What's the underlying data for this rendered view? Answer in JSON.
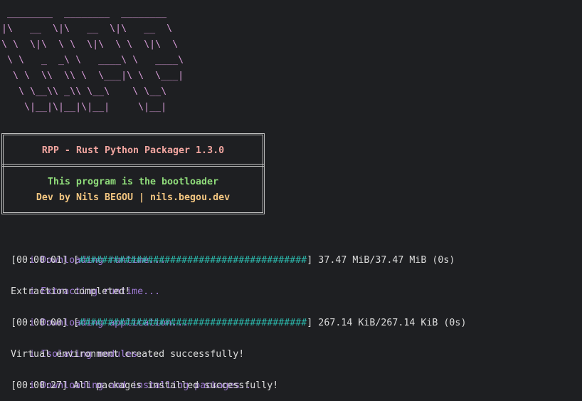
{
  "ascii_logo": [
    " ________  ________  ________",
    "|\\   __  \\|\\   __  \\|\\   __  \\",
    "\\ \\  \\|\\  \\ \\  \\|\\  \\ \\  \\|\\  \\",
    " \\ \\   _  _\\ \\   ____\\ \\   ____\\",
    "  \\ \\  \\\\  \\\\ \\  \\___|\\ \\  \\___|",
    "   \\ \\__\\\\ _\\\\ \\__\\    \\ \\__\\",
    "    \\|__|\\|__|\\|__|     \\|__|"
  ],
  "banner": {
    "title": "RPP - Rust Python Packager 1.3.0",
    "subtitle": "This program is the bootloader",
    "credit": "Dev by Nils BEGOU | nils.begou.dev"
  },
  "colors": {
    "background": "#1e1f22",
    "logo": "#d59ad6",
    "title": "#f2a6a0",
    "subtitle": "#8fdb7a",
    "credit": "#f2c580",
    "info": "#a07bd6",
    "progress": "#2bb4a8"
  },
  "log": {
    "info_icon": "i",
    "step1": "Downloading runtime...",
    "step1_time": "[00:00:01] [",
    "step1_bar": "########################################",
    "step1_end": "] 37.47 MiB/37.47 MiB (0s)",
    "step2": "Extracting runtime...",
    "step2_result": "Extraction completed!",
    "step3": "Downloading application...",
    "step3_time": "[00:00:00] [",
    "step3_bar": "########################################",
    "step3_end": "] 267.14 KiB/267.14 KiB (0s)",
    "step4": "Isolating modules...",
    "step4_result": "Virtual environment created successfully!",
    "step5": "Downloading and installing packages...",
    "step5_result": "[00:00:27] All packages installed successfully!"
  }
}
